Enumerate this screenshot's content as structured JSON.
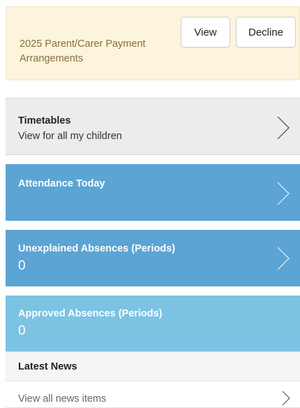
{
  "notice": {
    "text": "2025 Parent/Carer Payment Arrangements",
    "view_label": "View",
    "decline_label": "Decline"
  },
  "timetables": {
    "title": "Timetables",
    "subtitle": "View for all my children",
    "icon": "chevron-right-icon"
  },
  "attendance": {
    "title": "Attendance Today",
    "icon": "chevron-right-icon"
  },
  "unexplained": {
    "title": "Unexplained Absences (Periods)",
    "value": "0",
    "icon": "chevron-right-icon"
  },
  "approved": {
    "title": "Approved Absences (Periods)",
    "value": "0"
  },
  "news": {
    "header": "Latest News",
    "link_label": "View all news items",
    "icon": "chevron-right-icon"
  },
  "colors": {
    "notice_bg": "#fcf4dd",
    "notice_text": "#8a6d3b",
    "tile_blue": "#5ba4d4",
    "tile_light_blue": "#7cc2e3",
    "tile_grey": "#ececec"
  }
}
